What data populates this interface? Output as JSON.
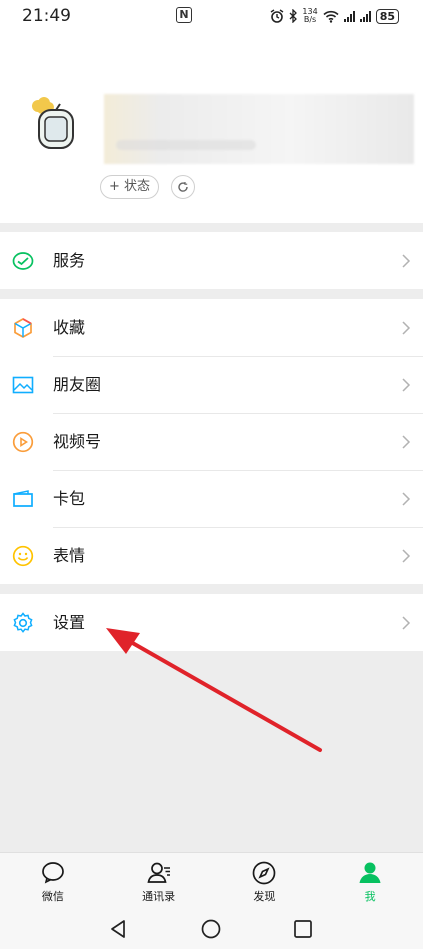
{
  "status_bar": {
    "time": "21:49",
    "nfc_badge": "N",
    "speed_value": "134",
    "speed_unit": "B/s",
    "battery": "85"
  },
  "profile": {
    "status_button": "+ 状态"
  },
  "menu": {
    "services": "服务",
    "favorites": "收藏",
    "moments": "朋友圈",
    "channels": "视频号",
    "cards": "卡包",
    "stickers": "表情",
    "settings": "设置"
  },
  "tabbar": {
    "chats": "微信",
    "contacts": "通讯录",
    "discover": "发现",
    "me": "我"
  },
  "colors": {
    "brand_green": "#07c160",
    "annotation_arrow": "#e0232a"
  }
}
